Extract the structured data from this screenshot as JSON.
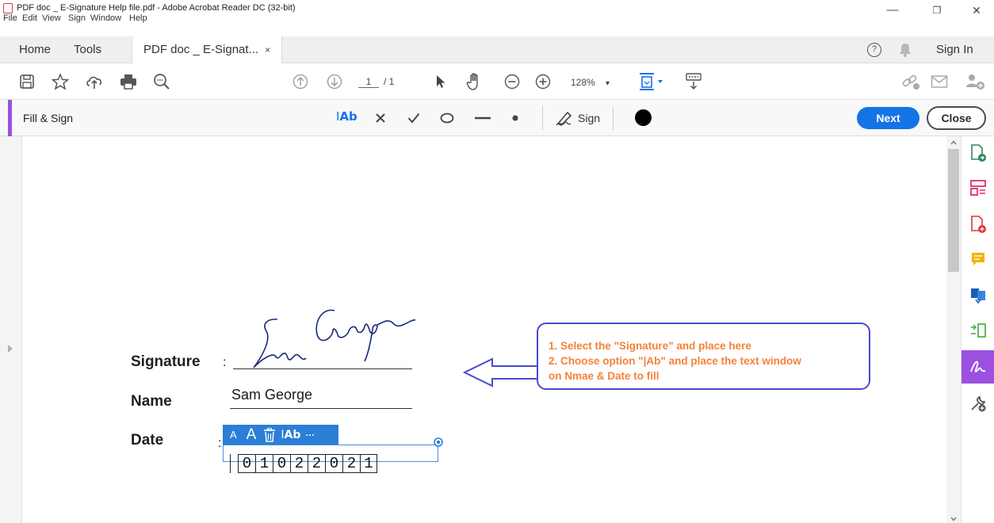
{
  "window": {
    "title": "PDF doc _ E-Signature Help file.pdf - Adobe Acrobat Reader DC (32-bit)",
    "menu": [
      "File",
      "Edit",
      "View",
      "Sign",
      "Window",
      "Help"
    ],
    "controls": {
      "minimize": "—",
      "restore": "❐",
      "close": "✕"
    }
  },
  "tabs": {
    "home": "Home",
    "tools": "Tools",
    "doc": "PDF doc _ E-Signat...",
    "doc_close": "×"
  },
  "header_right": {
    "help": "?",
    "sign_in": "Sign In"
  },
  "toolbar": {
    "page_current": "1",
    "page_total": "/ 1",
    "zoom": "128%",
    "zoom_caret": "▾"
  },
  "fill_sign": {
    "title": "Fill & Sign",
    "text_tool": "Ab",
    "sign_label": "Sign",
    "next": "Next",
    "close": "Close",
    "accent": "#9b50e0"
  },
  "document": {
    "signature_label": "Signature",
    "name_label": "Name",
    "date_label": "Date",
    "colon": ":",
    "signature_script": "Sam George",
    "name_value": "Sam George",
    "date_digits": [
      "0",
      "1",
      "0",
      "2",
      "2",
      "0",
      "2",
      "1"
    ],
    "field_toolbar": {
      "small_a": "A",
      "large_a": "A",
      "text_tool": "Ab",
      "more": "···"
    }
  },
  "callout": {
    "line1": "1. Select the \"Signature\" and place here",
    "line2": "2. Choose option \"|Ab\" and place the text window",
    "line3": "on Nmae & Date to fill",
    "color": "#f5823a",
    "border": "#4a4ad0"
  },
  "right_panel_icons": [
    "export-pdf-icon",
    "organize-pages-icon",
    "create-pdf-icon",
    "comment-icon",
    "combine-files-icon",
    "compress-icon",
    "fill-sign-icon",
    "more-tools-icon"
  ]
}
